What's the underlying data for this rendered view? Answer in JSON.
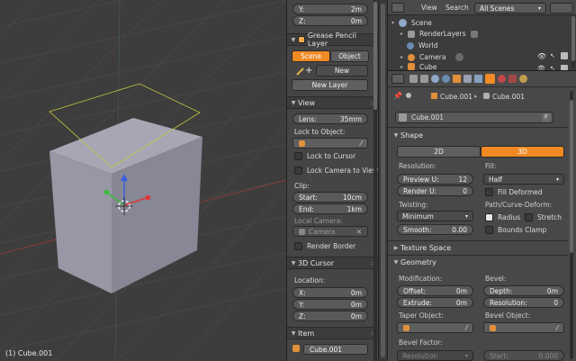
{
  "viewport": {
    "object_info": "(1) Cube.001"
  },
  "npanel": {
    "transform": {
      "y_label": "Y:",
      "y_value": "2m",
      "z_label": "Z:",
      "z_value": "0m"
    },
    "grease_pencil": {
      "title": "Grease Pencil Layer",
      "tab_scene": "Scene",
      "tab_object": "Object",
      "new_label": "New",
      "new_layer_label": "New Layer"
    },
    "view": {
      "title": "View",
      "lens_label": "Lens:",
      "lens_value": "35mm",
      "lock_to_object_label": "Lock to Object:",
      "lock_to_cursor": "Lock to Cursor",
      "lock_camera_to_view": "Lock Camera to View",
      "clip_label": "Clip:",
      "clip_start_label": "Start:",
      "clip_start_value": "10cm",
      "clip_end_label": "End:",
      "clip_end_value": "1km",
      "local_camera_label": "Local Camera:",
      "local_camera_value": "Camera",
      "render_border": "Render Border"
    },
    "cursor_3d": {
      "title": "3D Cursor",
      "location_label": "Location:",
      "x_label": "X:",
      "x_value": "0m",
      "y_label": "Y:",
      "y_value": "0m",
      "z_label": "Z:",
      "z_value": "0m"
    },
    "item": {
      "title": "Item",
      "name_value": "Cube.001"
    }
  },
  "outliner": {
    "header": {
      "view_label": "View",
      "search_label": "Search",
      "filter_value": "All Scenes"
    },
    "tree": [
      {
        "label": "Scene",
        "indent": 0
      },
      {
        "label": "RenderLayers",
        "indent": 1
      },
      {
        "label": "World",
        "indent": 1
      },
      {
        "label": "Camera",
        "indent": 1
      },
      {
        "label": "Cube",
        "indent": 1
      }
    ]
  },
  "properties": {
    "breadcrumb": {
      "object": "Cube.001",
      "data": "Cube.001"
    },
    "datablock": {
      "name": "Cube.001",
      "users": "F"
    },
    "shape": {
      "title": "Shape",
      "tab_2d": "2D",
      "tab_3d": "3D",
      "resolution_label": "Resolution:",
      "preview_u_label": "Preview U:",
      "preview_u_value": "12",
      "render_u_label": "Render U:",
      "render_u_value": "0",
      "fill_label": "Fill:",
      "fill_value": "Half",
      "fill_deformed": "Fill Deformed",
      "twisting_label": "Twisting:",
      "twisting_value": "Minimum",
      "smooth_label": "Smooth:",
      "smooth_value": "0.00",
      "path_deform_label": "Path/Curve-Deform:",
      "radius_label": "Radius",
      "stretch_label": "Stretch",
      "bounds_clamp_label": "Bounds Clamp"
    },
    "texture_space": {
      "title": "Texture Space"
    },
    "geometry": {
      "title": "Geometry",
      "modification_label": "Modification:",
      "offset_label": "Offset:",
      "offset_value": "0m",
      "extrude_label": "Extrude:",
      "extrude_value": "0m",
      "bevel_label": "Bevel:",
      "depth_label": "Depth:",
      "depth_value": "0m",
      "resolution_label": "Resolution:",
      "resolution_value": "0",
      "taper_object_label": "Taper Object:",
      "bevel_object_label": "Bevel Object:",
      "bevel_factor_label": "Bevel Factor:",
      "bf_resolution_label": "Resolution",
      "start_label": "Start:",
      "start_value": "0.000"
    }
  },
  "colors": {
    "accent": "#f08a24",
    "viewport_bg": "#3d3d3d",
    "cube_top": "#a5a5b3",
    "cube_left": "#9595a3",
    "cube_right": "#858593"
  }
}
